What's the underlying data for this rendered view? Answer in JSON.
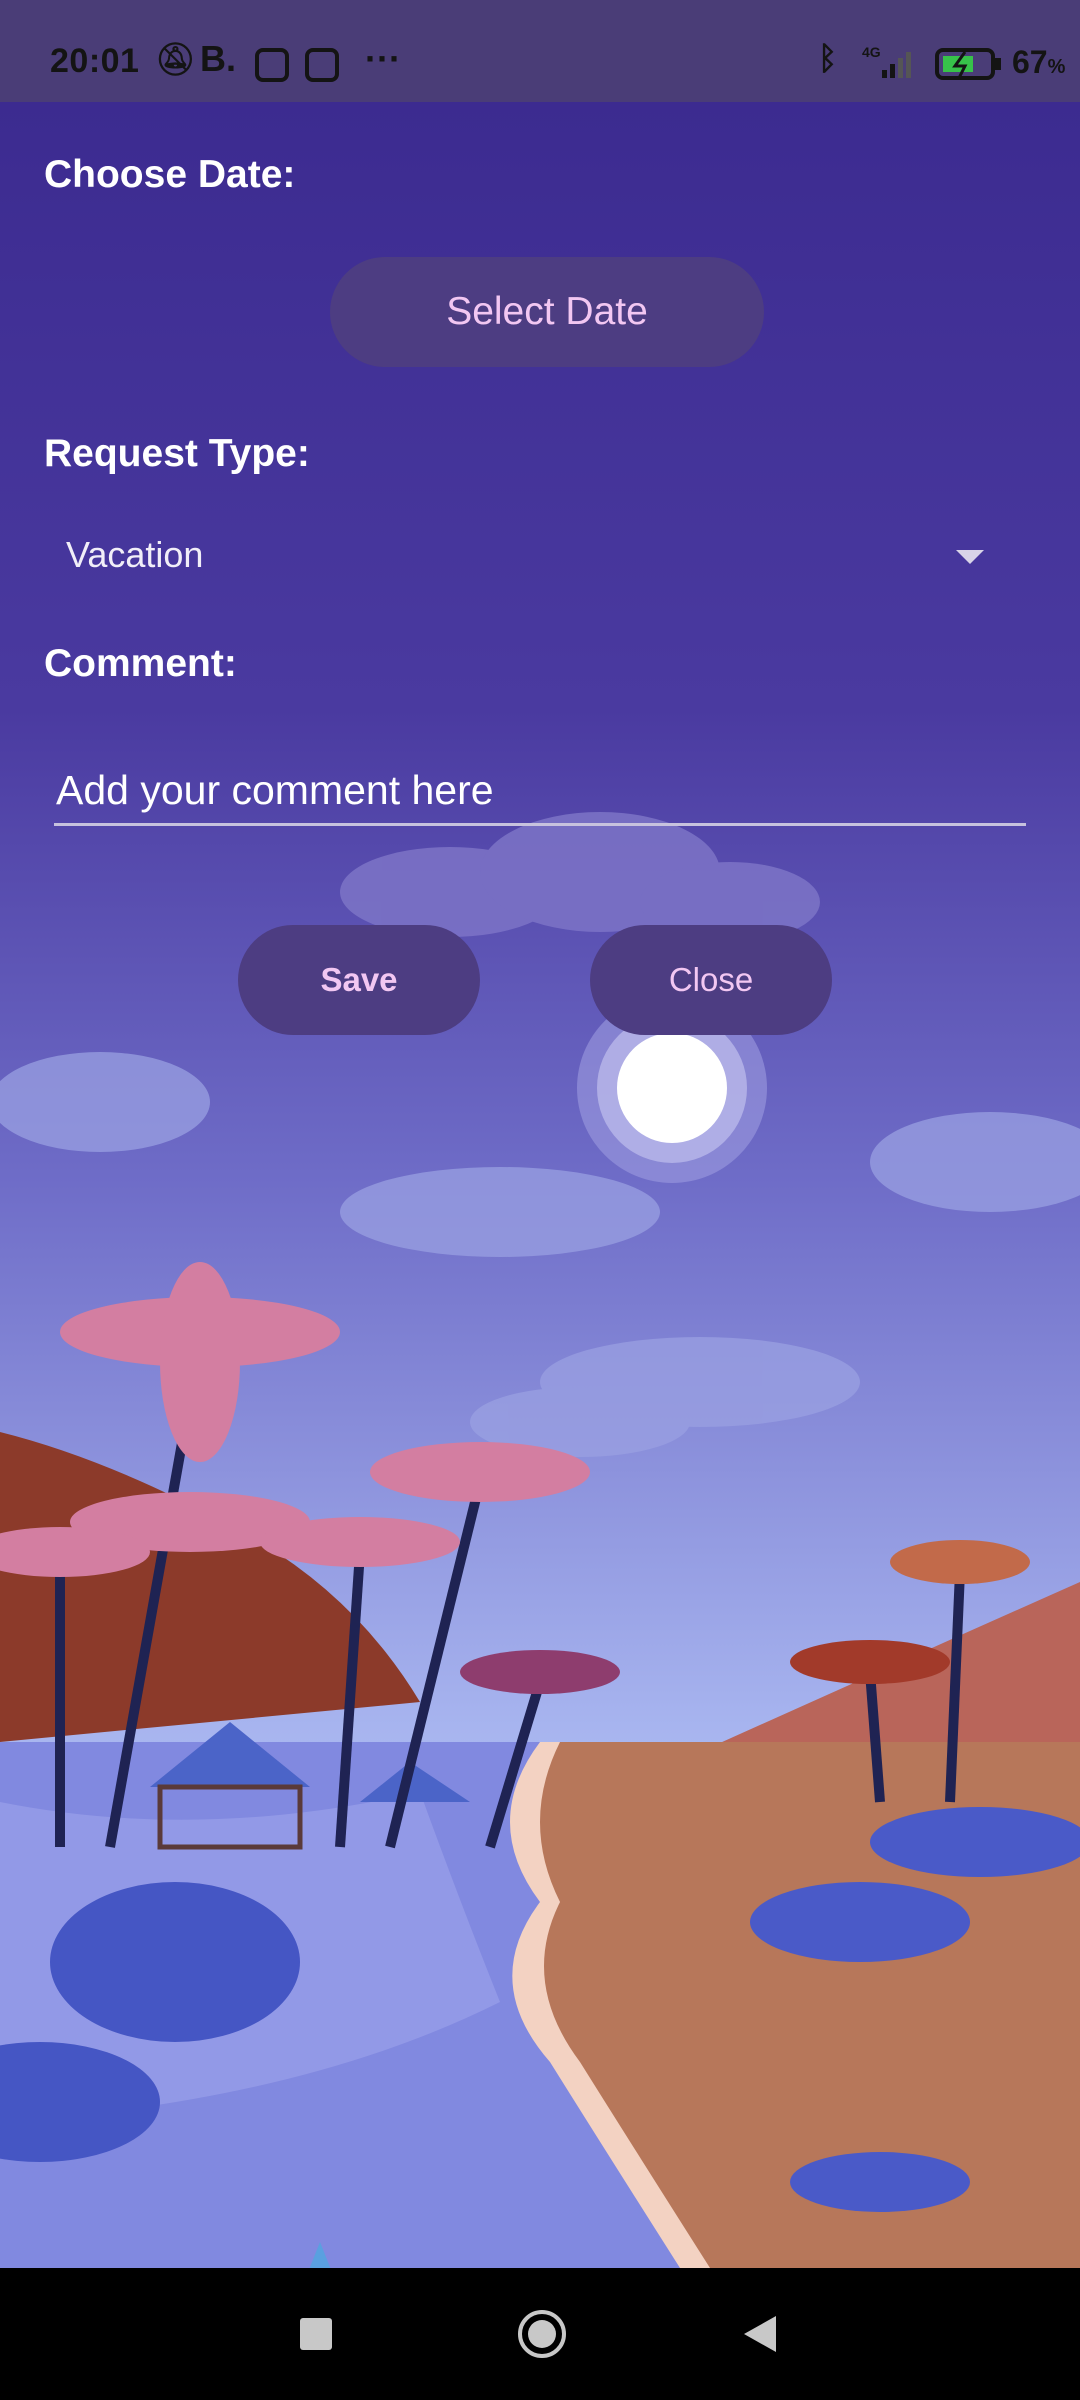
{
  "status_bar": {
    "time": "20:01",
    "battery": "67",
    "battery_unit": "%",
    "network": "4G",
    "more": "···",
    "notification_app_letter": "B."
  },
  "form": {
    "choose_date_label": "Choose Date:",
    "select_date_button": "Select Date",
    "request_type_label": "Request Type:",
    "request_type_value": "Vacation",
    "comment_label": "Comment:",
    "comment_placeholder": "Add your comment here",
    "save_button": "Save",
    "close_button": "Close"
  },
  "colors": {
    "background_top": "#3c2b90",
    "button_bg": "#4d3d82",
    "button_text": "#f2c7f2",
    "status_bar": "#4a3d77"
  },
  "icons": [
    "mute-icon",
    "instagram-icon",
    "bluetooth-icon",
    "signal-icon",
    "battery-icon",
    "dropdown-arrow-icon",
    "recent-apps-icon",
    "home-icon",
    "back-icon"
  ]
}
